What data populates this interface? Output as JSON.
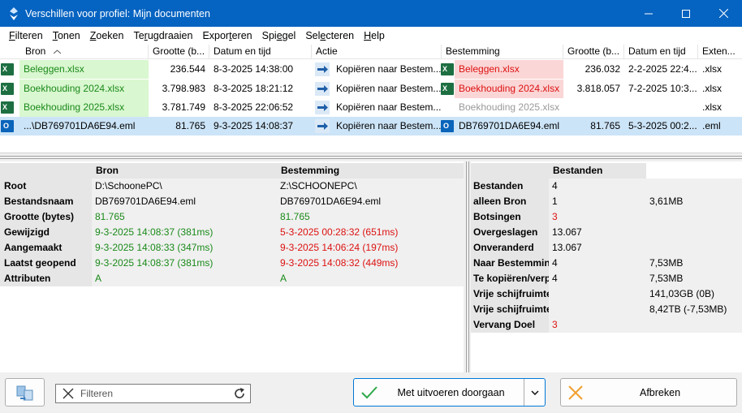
{
  "window": {
    "title": "Verschillen voor profiel: Mijn documenten"
  },
  "menu": [
    {
      "label": "Filteren",
      "key": "F",
      "rest": "ilteren"
    },
    {
      "label": "Tonen",
      "key": "T",
      "rest": "onen"
    },
    {
      "label": "Zoeken",
      "key": "Z",
      "rest": "oeken"
    },
    {
      "label": "Terugdraaien",
      "pre": "Te",
      "key": "r",
      "rest": "ugdraaien"
    },
    {
      "label": "Exporteren",
      "pre": "Expor",
      "key": "t",
      "rest": "eren"
    },
    {
      "label": "Spiegel",
      "pre": "Spi",
      "key": "e",
      "rest": "gel"
    },
    {
      "label": "Selecteren",
      "pre": "Sel",
      "key": "e",
      "rest": "cteren"
    },
    {
      "label": "Help",
      "key": "H",
      "rest": "elp"
    }
  ],
  "grid": {
    "headers": {
      "bron": "Bron",
      "grootte1": "Grootte (b...",
      "datum1": "Datum en tijd",
      "actie": "Actie",
      "bestemming": "Bestemming",
      "grootte2": "Grootte (b...",
      "datum2": "Datum en tijd",
      "ext": "Exten..."
    },
    "rows": [
      {
        "src_name": "Beleggen.xlsx",
        "src_size": "236.544",
        "src_date": "8-3-2025 14:38:00",
        "action": "Kopiëren naar Bestem...",
        "dst_name": "Beleggen.xlsx",
        "dst_size": "236.032",
        "dst_date": "2-2-2025 22:4...",
        "ext": ".xlsx",
        "src_icon": "excel-icon",
        "dst_icon": "excel-icon"
      },
      {
        "src_name": "Boekhouding 2024.xlsx",
        "src_size": "3.798.983",
        "src_date": "8-3-2025 18:21:12",
        "action": "Kopiëren naar Bestem...",
        "dst_name": "Boekhouding 2024.xlsx",
        "dst_size": "3.818.057",
        "dst_date": "7-2-2025 10:3...",
        "ext": ".xlsx",
        "src_icon": "excel-icon",
        "dst_icon": "excel-icon"
      },
      {
        "src_name": "Boekhouding 2025.xlsx",
        "src_size": "3.781.749",
        "src_date": "8-3-2025 22:06:52",
        "action": "Kopiëren naar Bestem...",
        "dst_name": "Boekhouding 2025.xlsx",
        "dst_size": "",
        "dst_date": "",
        "ext": ".xlsx",
        "src_icon": "excel-icon",
        "dst_icon": ""
      },
      {
        "src_name": "...\\DB769701DA6E94.eml",
        "src_size": "81.765",
        "src_date": "9-3-2025 14:08:37",
        "action": "Kopiëren naar Bestem...",
        "dst_name": "DB769701DA6E94.eml",
        "dst_size": "81.765",
        "dst_date": "5-3-2025 00:2...",
        "ext": ".eml",
        "src_icon": "outlook-icon",
        "dst_icon": "outlook-icon"
      }
    ]
  },
  "detail": {
    "col_src": "Bron",
    "col_dst": "Bestemming",
    "rows": [
      {
        "label": "Root",
        "src": "D:\\SchoonePC\\",
        "dst": "Z:\\SCHOONEPC\\"
      },
      {
        "label": "Bestandsnaam",
        "src": "DB769701DA6E94.eml",
        "dst": "DB769701DA6E94.eml"
      },
      {
        "label": "Grootte (bytes)",
        "src": "81.765",
        "dst": "81.765"
      },
      {
        "label": "Gewijzigd",
        "src": "9-3-2025 14:08:37 (381ms)",
        "dst": "5-3-2025 00:28:32 (651ms)"
      },
      {
        "label": "Aangemaakt",
        "src": "9-3-2025 14:08:33 (347ms)",
        "dst": "9-3-2025 14:06:24 (197ms)"
      },
      {
        "label": "Laatst geopend",
        "src": "9-3-2025 14:08:37 (381ms)",
        "dst": "9-3-2025 14:08:32 (449ms)"
      },
      {
        "label": "Attributen",
        "src": "A",
        "dst": "A"
      }
    ]
  },
  "stats": {
    "col_header": "Bestanden",
    "rows": [
      {
        "label": "Bestanden",
        "count": "4",
        "size": ""
      },
      {
        "label": "alleen Bron",
        "count": "1",
        "size": "3,61MB"
      },
      {
        "label": "Botsingen",
        "count": "3",
        "size": ""
      },
      {
        "label": "Overgeslagen",
        "count": "13.067",
        "size": ""
      },
      {
        "label": "Onveranderd",
        "count": "13.067",
        "size": ""
      },
      {
        "label": "Naar Bestemming",
        "count": "4",
        "size": "7,53MB"
      },
      {
        "label": "Te kopiëren/verplaatsen",
        "count": "4",
        "size": "7,53MB"
      },
      {
        "label": "Vrije schijfruimte",
        "count": "",
        "size": "141,03GB (0B)"
      },
      {
        "label": "Vrije schijfruimte",
        "count": "",
        "size": "8,42TB (-7,53MB)"
      },
      {
        "label": "Vervang Doel",
        "count": "3",
        "size": ""
      }
    ]
  },
  "bottom": {
    "filter_placeholder": "Filteren",
    "proceed_label": "Met uitvoeren doorgaan",
    "cancel_label": "Afbreken"
  }
}
